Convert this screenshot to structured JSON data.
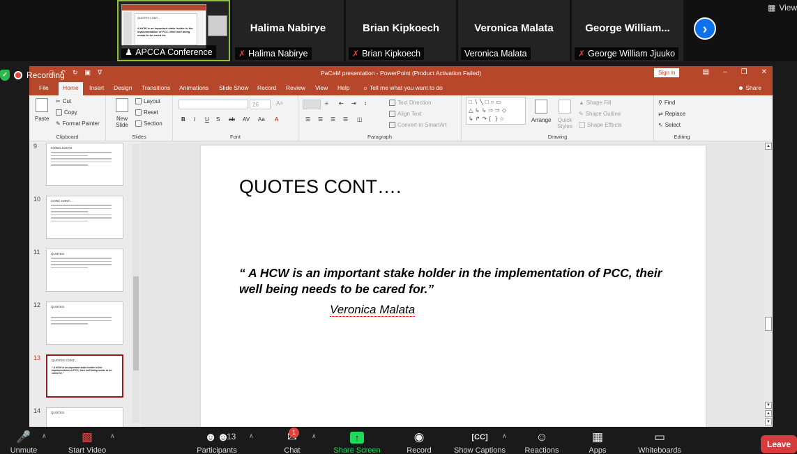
{
  "participants": {
    "active_tile": {
      "name": "APCCA Conference",
      "thumb_title": "QUOTES CONT...",
      "thumb_quote": "A HCW is an important stake holder in the implementation of PCC, their well being needs to be cared for."
    },
    "tiles": [
      {
        "display_name": "Halima Nabirye",
        "tag_name": "Halima Nabirye",
        "muted": true
      },
      {
        "display_name": "Brian Kipkoech",
        "tag_name": "Brian Kipkoech",
        "muted": true
      },
      {
        "display_name": "Veronica Malata",
        "tag_name": "Veronica Malata",
        "muted": false
      },
      {
        "display_name": "George  William...",
        "tag_name": "George William Jjuuko",
        "muted": true
      }
    ],
    "next_icon": "chevron-right-icon",
    "view_label": "View"
  },
  "recording": {
    "label": "Recording"
  },
  "powerpoint": {
    "window_title": "PaCeM presentation  -  PowerPoint (Product Activation Failed)",
    "sign_in": "Sign in",
    "tabs": [
      "File",
      "Home",
      "Insert",
      "Design",
      "Transitions",
      "Animations",
      "Slide Show",
      "Record",
      "Review",
      "View",
      "Help"
    ],
    "tell_me": "Tell me what you want to do",
    "share": "Share",
    "ribbon": {
      "clipboard": {
        "label": "Clipboard",
        "paste": "Paste",
        "cut": "Cut",
        "copy": "Copy",
        "format_painter": "Format Painter"
      },
      "slides": {
        "label": "Slides",
        "new_slide": "New Slide",
        "layout": "Layout",
        "reset": "Reset",
        "section": "Section"
      },
      "font": {
        "label": "Font",
        "size": "26"
      },
      "paragraph": {
        "label": "Paragraph",
        "text_direction": "Text Direction",
        "align_text": "Align Text",
        "convert_smartart": "Convert to SmartArt"
      },
      "drawing": {
        "label": "Drawing",
        "arrange": "Arrange",
        "quick_styles": "Quick Styles",
        "shape_fill": "Shape Fill",
        "shape_outline": "Shape Outline",
        "shape_effects": "Shape Effects"
      },
      "editing": {
        "label": "Editing",
        "find": "Find",
        "replace": "Replace",
        "select": "Select"
      }
    },
    "slides": [
      {
        "num": "9",
        "title": "CONCLUSION"
      },
      {
        "num": "10",
        "title": "CONC CONT...."
      },
      {
        "num": "11",
        "title": "QUOTES"
      },
      {
        "num": "12",
        "title": "QUOTES"
      },
      {
        "num": "13",
        "title": "QUOTES CONT...."
      },
      {
        "num": "14",
        "title": "QUOTES"
      }
    ],
    "current_slide": {
      "title": "QUOTES CONT….",
      "quote": "“ A HCW is an important stake holder in the implementation of PCC, their well being needs to be cared for.”",
      "author": "Veronica Malata"
    }
  },
  "toolbar": {
    "unmute": "Unmute",
    "start_video": "Start Video",
    "participants": "Participants",
    "participants_count": "13",
    "chat": "Chat",
    "chat_badge": "1",
    "share_screen": "Share Screen",
    "record": "Record",
    "show_captions": "Show Captions",
    "reactions": "Reactions",
    "apps": "Apps",
    "whiteboards": "Whiteboards",
    "leave": "Leave"
  }
}
